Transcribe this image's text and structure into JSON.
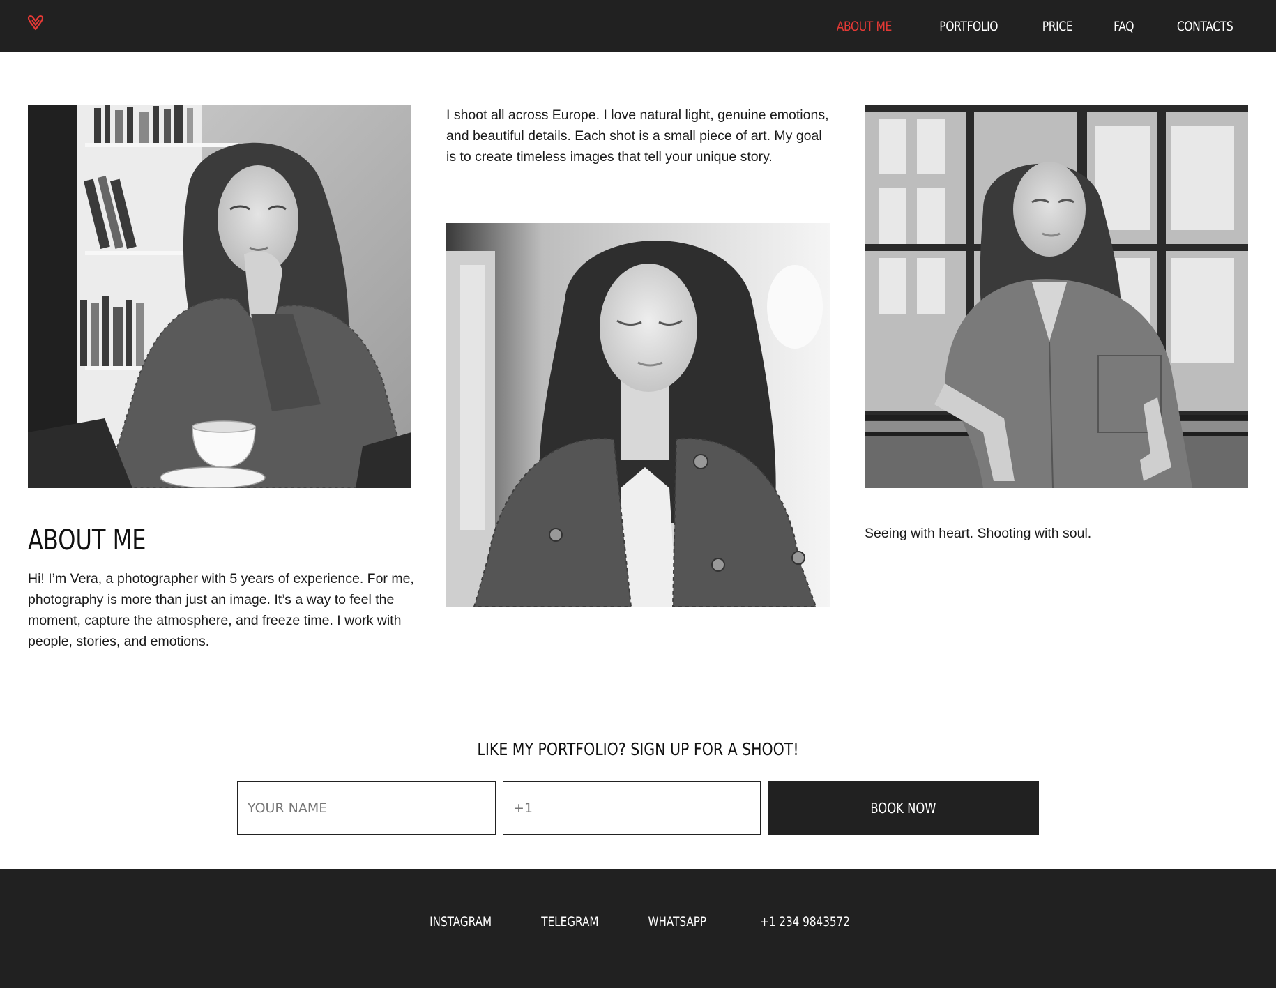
{
  "colors": {
    "header_bg": "#212121",
    "accent": "#e53935",
    "footer_bg": "#212121"
  },
  "header": {
    "logo_icon": "heart-v-logo-icon",
    "nav": [
      {
        "label": "ABOUT ME",
        "active": true
      },
      {
        "label": "PORTFOLIO",
        "active": false
      },
      {
        "label": "PRICE",
        "active": false
      },
      {
        "label": "FAQ",
        "active": false
      },
      {
        "label": "CONTACTS",
        "active": false
      }
    ]
  },
  "about": {
    "title": "ABOUT ME",
    "text": "Hi! I’m Vera, a photographer with 5 years of experience. For me, photography is more than just an image. It’s a way to feel the moment, capture the atmosphere, and freeze time. I work with people, stories, and emotions."
  },
  "intro": {
    "text": "I shoot all across Europe. I love natural light, genuine emotions, and beautiful details. Each shot is a small piece of art. My goal is to create timeless images that tell your unique story."
  },
  "tagline": {
    "text": "Seeing with heart. Shooting with soul."
  },
  "photos": [
    {
      "name": "woman-cafe-photo"
    },
    {
      "name": "woman-jacket-photo"
    },
    {
      "name": "woman-window-photo"
    }
  ],
  "signup": {
    "title": "LIKE MY PORTFOLIO? SIGN UP FOR A SHOOT!",
    "name_placeholder": "YOUR NAME",
    "phone_placeholder": "+1",
    "button_label": "BOOK NOW"
  },
  "footer": {
    "links": [
      "INSTAGRAM",
      "TELEGRAM",
      "WHATSAPP",
      "+1 234 9843572"
    ]
  }
}
